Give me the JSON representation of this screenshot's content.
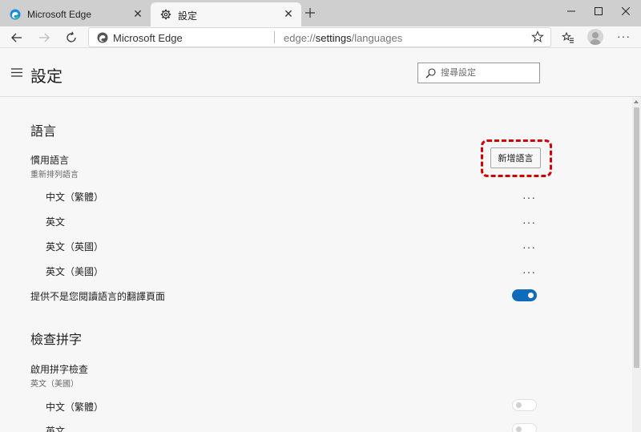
{
  "browser": {
    "tabs": [
      {
        "label": "Microsoft Edge",
        "active": false
      },
      {
        "label": "設定",
        "active": true
      }
    ],
    "omnibox": {
      "site_name": "Microsoft Edge",
      "url_prefix": "edge://",
      "url_host": "settings",
      "url_path": "/languages"
    },
    "accent_color": "#0f6cbd"
  },
  "settings": {
    "title": "設定",
    "search_placeholder": "搜尋設定"
  },
  "languages_section": {
    "title": "語言",
    "preferred_label": "慣用語言",
    "preferred_sublabel": "重新排列語言",
    "add_button_label": "新增語言",
    "items": [
      {
        "label": "中文（繁體）"
      },
      {
        "label": "英文"
      },
      {
        "label": "英文（英國）"
      },
      {
        "label": "英文（美國）"
      }
    ],
    "more_actions_glyph": "···",
    "offer_translate_label": "提供不是您閱讀語言的翻譯頁面",
    "offer_translate_on": true
  },
  "spellcheck_section": {
    "title": "檢查拼字",
    "enable_label": "啟用拼字檢查",
    "enable_sublabel": "英文（美國）",
    "items": [
      {
        "label": "中文（繁體）",
        "enabled": false
      },
      {
        "label": "英文",
        "enabled": false
      }
    ]
  },
  "annotation": {
    "highlight_color": "#d10000"
  }
}
